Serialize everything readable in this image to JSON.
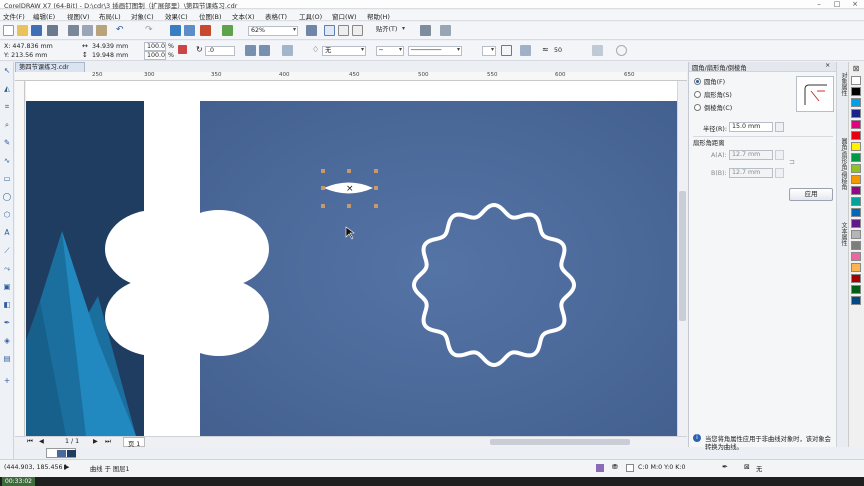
{
  "window": {
    "title": "CorelDRAW X7 (64-Bit) - D:\\cdr\\3 插画钉图制（扩展部里）\\第四节课练习.cdr"
  },
  "menu": [
    "文件(F)",
    "编辑(E)",
    "视图(V)",
    "布局(L)",
    "对象(C)",
    "效果(C)",
    "位图(B)",
    "文本(X)",
    "表格(T)",
    "工具(O)",
    "窗口(W)",
    "帮助(H)"
  ],
  "toolbar": {
    "zoom": "62%",
    "snap_label": "贴齐(T)"
  },
  "property_bar": {
    "x": "X: 447.836 mm",
    "y": "Y: 213.56 mm",
    "width": "34.939 mm",
    "height": "19.948 mm",
    "scale_x": "100.0",
    "scale_y": "100.0",
    "pct": "%",
    "rotation": ".0",
    "fill_none": "无",
    "outline_value": "50"
  },
  "document": {
    "tab": "第四节课练习.cdr",
    "ruler_h": [
      "250",
      "300",
      "350",
      "400",
      "450",
      "500",
      "550",
      "600",
      "650"
    ],
    "page_nav": "1 / 1",
    "page_tab": "页 1"
  },
  "docker": {
    "title": "圆角/扇形角/倒棱角",
    "options": [
      "圆角(F)",
      "扇形角(S)",
      "倒棱角(C)"
    ],
    "selected_option": 0,
    "radius_label": "半径(R):",
    "radius_value": "15.0 mm",
    "scallop_section": "扇形角距离",
    "a_label": "A(A):",
    "a_value": "12.7 mm",
    "b_label": "B(B):",
    "b_value": "12.7 mm",
    "apply_button": "应用",
    "info": "当您将角属性应用于非曲线对象时，该对象会转换为曲线。"
  },
  "docker_tabs": [
    "圆角/扇形角/倒棱角",
    "对象属性",
    "文本属性"
  ],
  "palette": [
    "#ffffff",
    "#000000",
    "#00a0e9",
    "#1d2088",
    "#e4007f",
    "#e60012",
    "#fff100",
    "#009944",
    "#8fc31f",
    "#f39800",
    "#920783",
    "#00a29a",
    "#0068b7",
    "#601986",
    "#b5b5b6",
    "#7d7d7d",
    "#ea68a2",
    "#f8b551",
    "#a40000",
    "#005e15",
    "#004986"
  ],
  "status": {
    "coords": "(444.903, 185.456 )",
    "object_info": "曲线 于 图层1",
    "color_info": "C:0 M:0 Y:0 K:0",
    "fill_none": "无",
    "time": "00:33:02"
  },
  "colors": {
    "background_blue": "#4a6899",
    "left_dark": "#1f3d60",
    "triangle_teal": "#1a7cb0",
    "shape_white": "#ffffff"
  }
}
